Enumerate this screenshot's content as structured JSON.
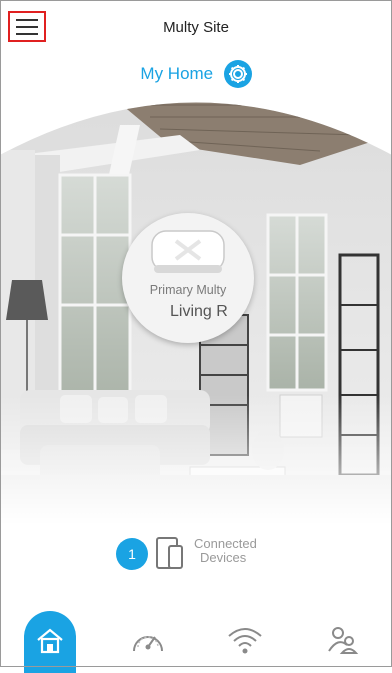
{
  "header": {
    "title": "Multy Site"
  },
  "home": {
    "title": "My Home"
  },
  "device": {
    "name": "Primary Multy",
    "location": "Living R"
  },
  "connected": {
    "count": "1",
    "line1": "Connected",
    "line2": "Devices"
  },
  "colors": {
    "accent": "#1aa3e3"
  },
  "icons": [
    "menu-icon",
    "gear-icon",
    "router-icon",
    "phone-tablet-icon",
    "home-icon",
    "speedometer-icon",
    "wifi-icon",
    "parental-control-icon"
  ]
}
